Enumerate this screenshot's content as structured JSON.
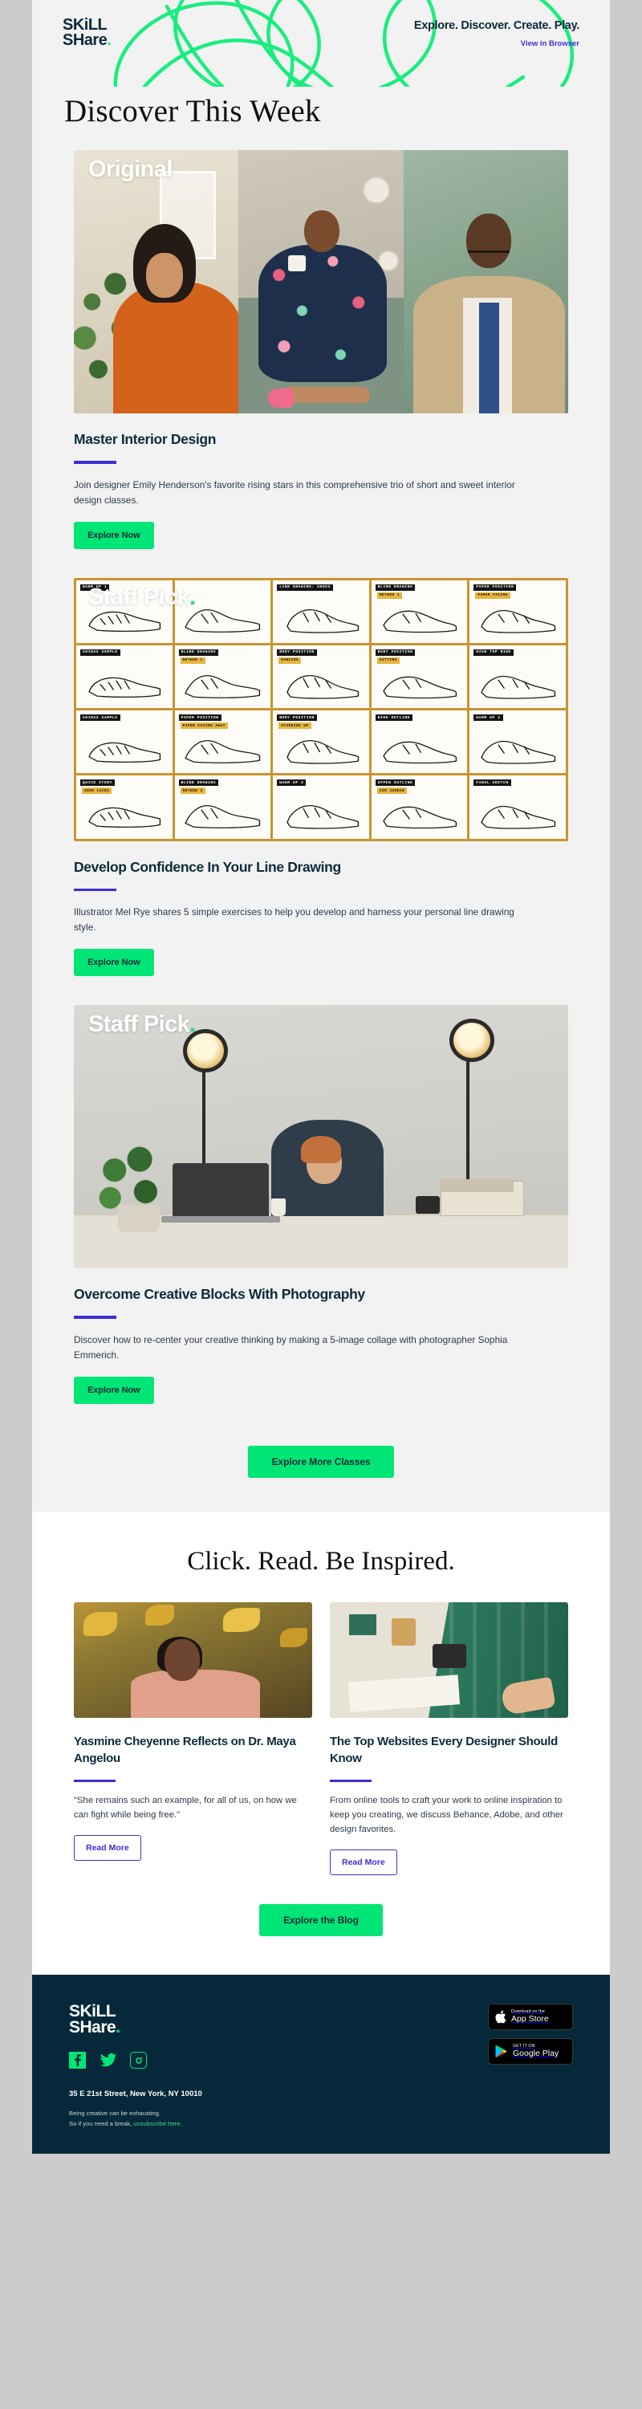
{
  "header": {
    "logo_line1": "SKiLL",
    "logo_line2": "SHare",
    "logo_dot": ".",
    "tagline": "Explore. Discover. Create. Play.",
    "view_in_browser": "View in Browser"
  },
  "hero": {
    "title": "Discover This Week"
  },
  "cards": [
    {
      "badge": "Original",
      "badge_dot": "",
      "title": "Master Interior Design",
      "description": "Join designer Emily Henderson's favorite rising stars in this comprehensive trio of short and sweet interior design classes.",
      "cta": "Explore Now"
    },
    {
      "badge": "Staff Pick",
      "badge_dot": ".",
      "title": "Develop Confidence In Your Line Drawing",
      "description": "Illustrator Mel Rye shares 5 simple exercises to help you develop and harness your personal line drawing style.",
      "cta": "Explore Now"
    },
    {
      "badge": "Staff Pick",
      "badge_dot": ".",
      "title": "Overcome Creative Blocks With Photography",
      "description": "Discover how to re-center your creative thinking by making a 5-image collage with photographer Sophia Emmerich.",
      "cta": "Explore Now"
    }
  ],
  "classes_cta": "Explore More Classes",
  "sneaker_grid": [
    {
      "tag": "WARM UP 1",
      "sub": ""
    },
    {
      "tag": "",
      "sub": ""
    },
    {
      "tag": "LINE DRAWING: SHOES",
      "sub": ""
    },
    {
      "tag": "BLIND DRAWING",
      "sub": "METHOD 1"
    },
    {
      "tag": "PAPER POSITION",
      "sub": "PAPER FACING"
    },
    {
      "tag": "ADIDAS SAMPLE",
      "sub": ""
    },
    {
      "tag": "BLIND DRAWING",
      "sub": "METHOD 1"
    },
    {
      "tag": "BODY POSITION",
      "sub": "DANCING"
    },
    {
      "tag": "BODY POSITION",
      "sub": "SITTING"
    },
    {
      "tag": "HIGH TOP NIKE",
      "sub": ""
    },
    {
      "tag": "ADIDAS SAMPLE",
      "sub": ""
    },
    {
      "tag": "PAPER POSITION",
      "sub": "PAPER FACING AWAY"
    },
    {
      "tag": "BODY POSITION",
      "sub": "STANDING UP"
    },
    {
      "tag": "NIKE OUTLINE",
      "sub": ""
    },
    {
      "tag": "WARM UP 2",
      "sub": ""
    },
    {
      "tag": "QUICK STUDY",
      "sub": "SHOE LACES"
    },
    {
      "tag": "BLIND DRAWING",
      "sub": "METHOD 2"
    },
    {
      "tag": "WARM UP 3",
      "sub": ""
    },
    {
      "tag": "UPPER OUTLINE",
      "sub": "AIR JORDAN"
    },
    {
      "tag": "FINAL SKETCH",
      "sub": ""
    }
  ],
  "blog": {
    "heading": "Click. Read. Be Inspired.",
    "articles": [
      {
        "title": "Yasmine Cheyenne Reflects on Dr. Maya Angelou",
        "excerpt": "\"She remains such an example, for all of us, on how we can fight while being free.\"",
        "cta": "Read More"
      },
      {
        "title": "The Top Websites Every Designer Should Know",
        "excerpt": "From online tools to craft your work to online inspiration to keep you creating, we discuss Behance, Adobe, and other design favorites.",
        "cta": "Read More"
      }
    ],
    "cta": "Explore the Blog"
  },
  "footer": {
    "logo_line1": "SKiLL",
    "logo_line2": "SHare",
    "logo_dot": ".",
    "socials": [
      "facebook-icon",
      "twitter-icon",
      "instagram-icon"
    ],
    "app_store": {
      "small": "Download on the",
      "big": "App Store"
    },
    "google_play": {
      "small": "GET IT ON",
      "big": "Google Play"
    },
    "address": "35 E 21st Street, New York, NY 10010",
    "legal_line1": "Being creative can be exhausting.",
    "legal_line2_prefix": "So if you need a break, ",
    "legal_link": "unsubscribe here",
    "legal_line2_suffix": "."
  },
  "colors": {
    "green": "#00e676",
    "dark_navy": "#05293a",
    "indigo": "#3d2fd6",
    "page_bg": "#f2f2f2",
    "gold": "#c8952f"
  }
}
